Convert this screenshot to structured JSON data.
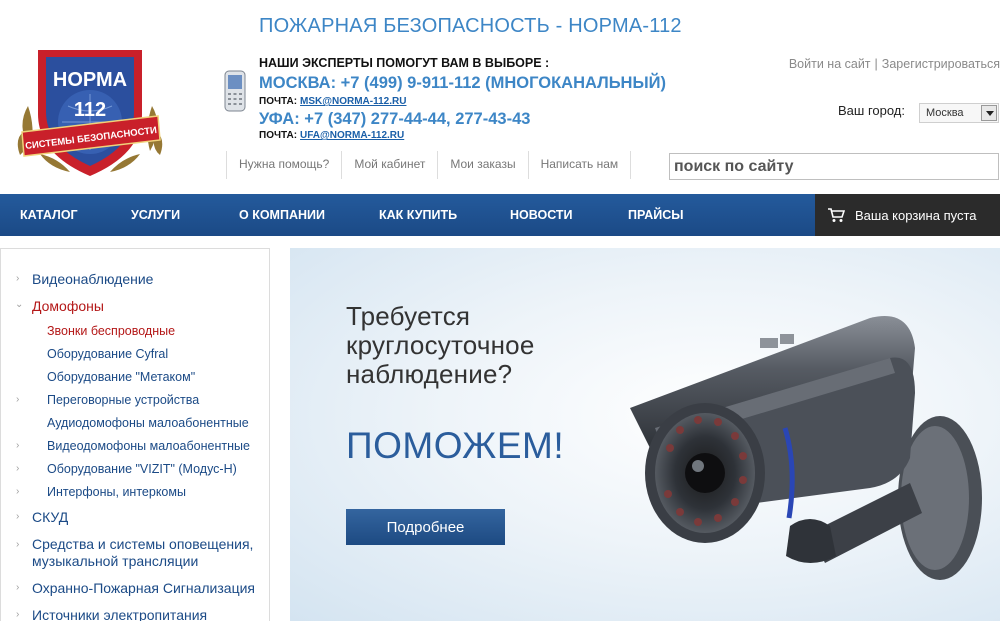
{
  "header": {
    "logo_top": "НОРМА",
    "logo_num": "112",
    "logo_ribbon": "СИСТЕМЫ БЕЗОПАСНОСТИ",
    "site_title": "ПОЖАРНАЯ БЕЗОПАСНОСТЬ - НОРМА-112",
    "experts": "НАШИ ЭКСПЕРТЫ ПОМОГУТ ВАМ В ВЫБОРЕ :",
    "msk_phone": "МОСКВА: +7 (499) 9-911-112 (МНОГОКАНАЛЬНЫЙ)",
    "msk_mail_label": "ПОЧТА:",
    "msk_mail": "MSK@NORMA-112.RU",
    "ufa_phone": "УФА: +7 (347) 277-44-44, 277-43-43",
    "ufa_mail_label": "ПОЧТА:",
    "ufa_mail": "UFA@NORMA-112.RU",
    "login": "Войти на сайт",
    "separator": "|",
    "register": "Зарегистрироваться",
    "city_label": "Ваш город:",
    "city_value": "Москва",
    "quick_links": [
      "Нужна помощь?",
      "Мой кабинет",
      "Мои заказы",
      "Написать нам"
    ],
    "search_placeholder": "поиск по сайту"
  },
  "nav": {
    "items": [
      "КАТАЛОГ",
      "УСЛУГИ",
      "О КОМПАНИИ",
      "КАК КУПИТЬ",
      "НОВОСТИ",
      "ПРАЙСЫ"
    ],
    "cart": "Ваша корзина пуста"
  },
  "sidebar": {
    "categories": [
      {
        "label": "Видеонаблюдение",
        "state": "collapsed"
      },
      {
        "label": "Домофоны",
        "state": "expanded"
      },
      {
        "label": "СКУД",
        "state": "collapsed"
      },
      {
        "label": "Средства и системы оповещения, музыкальной трансляции",
        "state": "collapsed"
      },
      {
        "label": "Охранно-Пожарная Сигнализация",
        "state": "collapsed"
      },
      {
        "label": "Источники электропитания",
        "state": "collapsed"
      }
    ],
    "subcategories": [
      {
        "label": "Звонки беспроводные",
        "active": true,
        "has_children": false
      },
      {
        "label": "Оборудование Cyfral",
        "active": false,
        "has_children": false
      },
      {
        "label": "Оборудование \"Метаком\"",
        "active": false,
        "has_children": false
      },
      {
        "label": "Переговорные устройства",
        "active": false,
        "has_children": true
      },
      {
        "label": "Аудиодомофоны малоабонентные",
        "active": false,
        "has_children": false
      },
      {
        "label": "Видеодомофоны малоабонентные",
        "active": false,
        "has_children": true
      },
      {
        "label": "Оборудование \"VIZIT\" (Модус-Н)",
        "active": false,
        "has_children": true
      },
      {
        "label": "Интерфоны, интеркомы",
        "active": false,
        "has_children": true
      }
    ]
  },
  "banner": {
    "line1": "Требуется",
    "line2": "круглосуточное",
    "line3": "наблюдение?",
    "cta": "ПОМОЖЕМ!",
    "button": "Подробнее"
  },
  "colors": {
    "accent": "#3d86c6",
    "nav_bg": "#1f4f8c",
    "cart_bg": "#2b2b2b",
    "link": "#1b4a86",
    "active_link": "#b41818"
  },
  "icons": {
    "logo": "shield-logo",
    "phone": "mobile-phone-icon",
    "cart": "shopping-cart-icon",
    "dropdown": "chevron-down-icon",
    "bullet": "chevron-right-icon"
  }
}
